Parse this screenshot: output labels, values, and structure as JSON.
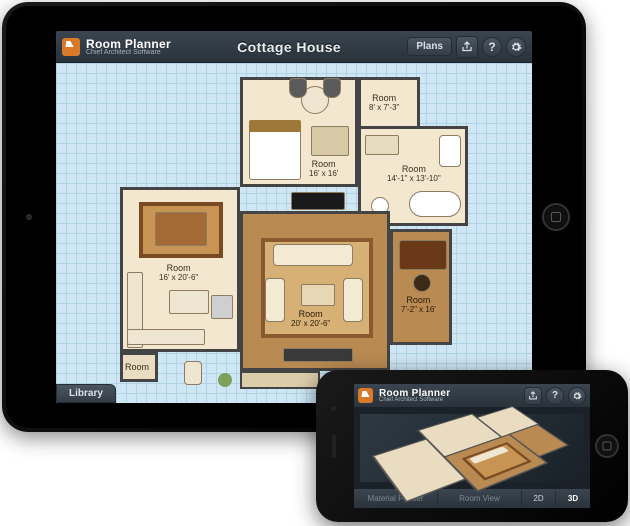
{
  "app": {
    "name": "Room Planner",
    "subtitle": "Chief Architect Software"
  },
  "ipad": {
    "title": "Cottage House",
    "toolbar": {
      "plans_label": "Plans",
      "share_icon": "share-icon",
      "help_icon": "help-icon",
      "settings_icon": "settings-icon"
    },
    "library_button": "Library",
    "rooms": [
      {
        "id": "bedroom",
        "name": "Room",
        "dimensions": "16' x 16'"
      },
      {
        "id": "closet",
        "name": "Room",
        "dimensions": "8' x 7'-3\""
      },
      {
        "id": "bath",
        "name": "Room",
        "dimensions": "14'-1\" x 13'-10\""
      },
      {
        "id": "dining",
        "name": "Room",
        "dimensions": "16' x 20'-6\""
      },
      {
        "id": "living",
        "name": "Room",
        "dimensions": "20' x 20'-6\""
      },
      {
        "id": "study",
        "name": "Room",
        "dimensions": "7'-2\" x 16'"
      },
      {
        "id": "pantry",
        "name": "Room",
        "dimensions": ""
      }
    ]
  },
  "iphone": {
    "bottom_tabs": {
      "material_painter": "Material Painter",
      "room_view": "Room View",
      "mode_2d": "2D",
      "mode_3d": "3D"
    }
  },
  "colors": {
    "toolbar_top": "#3a4550",
    "toolbar_bottom": "#2a333b",
    "grid_bg": "#cfe7f4",
    "floor_light": "#f3e7cf",
    "floor_wood": "#b98a52",
    "accent": "#d97a2a"
  }
}
